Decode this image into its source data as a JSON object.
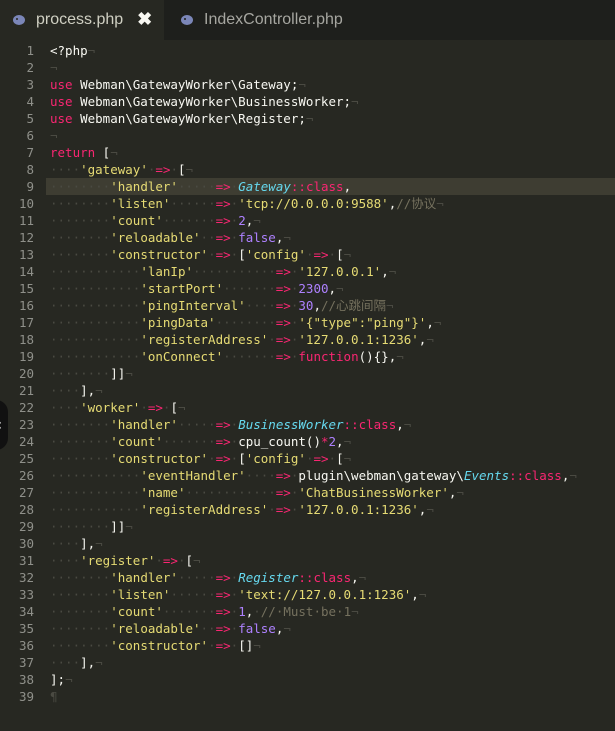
{
  "tabs": [
    {
      "label": "process.php",
      "active": true,
      "close_glyph": "✖",
      "icon": "php-elephant-icon"
    },
    {
      "label": "IndexController.php",
      "active": false,
      "icon": "php-elephant-icon"
    }
  ],
  "current_line": 9,
  "colors": {
    "background": "#272822",
    "keyword": "#f92672",
    "string": "#e6db74",
    "number": "#ae81ff",
    "class": "#66d9ef",
    "comment": "#75715e"
  },
  "lines": [
    [
      [
        "t",
        "<?php"
      ],
      [
        "w",
        "¬"
      ]
    ],
    [
      [
        "w",
        "¬"
      ]
    ],
    [
      [
        "kw",
        "use"
      ],
      [
        "t",
        " Webman\\GatewayWorker\\Gateway;"
      ],
      [
        "w",
        "¬"
      ]
    ],
    [
      [
        "kw",
        "use"
      ],
      [
        "t",
        " Webman\\GatewayWorker\\BusinessWorker;"
      ],
      [
        "w",
        "¬"
      ]
    ],
    [
      [
        "kw",
        "use"
      ],
      [
        "t",
        " Webman\\GatewayWorker\\Register;"
      ],
      [
        "w",
        "¬"
      ]
    ],
    [
      [
        "w",
        "¬"
      ]
    ],
    [
      [
        "kw",
        "return"
      ],
      [
        "t",
        " ["
      ],
      [
        "w",
        "¬"
      ]
    ],
    [
      [
        "w",
        "····"
      ],
      [
        "str",
        "'gateway'"
      ],
      [
        "w",
        "·"
      ],
      [
        "op",
        "=>"
      ],
      [
        "w",
        "·"
      ],
      [
        "t",
        "["
      ],
      [
        "w",
        "¬"
      ]
    ],
    [
      [
        "w",
        "········"
      ],
      [
        "str",
        "'handler'"
      ],
      [
        "w",
        "·····"
      ],
      [
        "op",
        "=>"
      ],
      [
        "w",
        "·"
      ],
      [
        "cls",
        "Gateway"
      ],
      [
        "op",
        "::"
      ],
      [
        "kw",
        "class"
      ],
      [
        "t",
        ","
      ]
    ],
    [
      [
        "w",
        "········"
      ],
      [
        "str",
        "'listen'"
      ],
      [
        "w",
        "······"
      ],
      [
        "op",
        "=>"
      ],
      [
        "w",
        "·"
      ],
      [
        "str",
        "'tcp://0.0.0.0:9588'"
      ],
      [
        "t",
        ","
      ],
      [
        "cm",
        "//协议"
      ],
      [
        "w",
        "¬"
      ]
    ],
    [
      [
        "w",
        "········"
      ],
      [
        "str",
        "'count'"
      ],
      [
        "w",
        "·······"
      ],
      [
        "op",
        "=>"
      ],
      [
        "w",
        "·"
      ],
      [
        "num",
        "2"
      ],
      [
        "t",
        ","
      ],
      [
        "w",
        "¬"
      ]
    ],
    [
      [
        "w",
        "········"
      ],
      [
        "str",
        "'reloadable'"
      ],
      [
        "w",
        "··"
      ],
      [
        "op",
        "=>"
      ],
      [
        "w",
        "·"
      ],
      [
        "num",
        "false"
      ],
      [
        "t",
        ","
      ],
      [
        "w",
        "¬"
      ]
    ],
    [
      [
        "w",
        "········"
      ],
      [
        "str",
        "'constructor'"
      ],
      [
        "w",
        "·"
      ],
      [
        "op",
        "=>"
      ],
      [
        "w",
        "·"
      ],
      [
        "t",
        "["
      ],
      [
        "str",
        "'config'"
      ],
      [
        "w",
        "·"
      ],
      [
        "op",
        "=>"
      ],
      [
        "w",
        "·"
      ],
      [
        "t",
        "["
      ],
      [
        "w",
        "¬"
      ]
    ],
    [
      [
        "w",
        "············"
      ],
      [
        "str",
        "'lanIp'"
      ],
      [
        "w",
        "···········"
      ],
      [
        "op",
        "=>"
      ],
      [
        "w",
        "·"
      ],
      [
        "str",
        "'127.0.0.1'"
      ],
      [
        "t",
        ","
      ],
      [
        "w",
        "¬"
      ]
    ],
    [
      [
        "w",
        "············"
      ],
      [
        "str",
        "'startPort'"
      ],
      [
        "w",
        "·······"
      ],
      [
        "op",
        "=>"
      ],
      [
        "w",
        "·"
      ],
      [
        "num",
        "2300"
      ],
      [
        "t",
        ","
      ],
      [
        "w",
        "¬"
      ]
    ],
    [
      [
        "w",
        "············"
      ],
      [
        "str",
        "'pingInterval'"
      ],
      [
        "w",
        "····"
      ],
      [
        "op",
        "=>"
      ],
      [
        "w",
        "·"
      ],
      [
        "num",
        "30"
      ],
      [
        "t",
        ","
      ],
      [
        "cm",
        "//心跳间隔"
      ],
      [
        "w",
        "¬"
      ]
    ],
    [
      [
        "w",
        "············"
      ],
      [
        "str",
        "'pingData'"
      ],
      [
        "w",
        "········"
      ],
      [
        "op",
        "=>"
      ],
      [
        "w",
        "·"
      ],
      [
        "str",
        "'{\"type\":\"ping\"}'"
      ],
      [
        "t",
        ","
      ],
      [
        "w",
        "¬"
      ]
    ],
    [
      [
        "w",
        "············"
      ],
      [
        "str",
        "'registerAddress'"
      ],
      [
        "w",
        "·"
      ],
      [
        "op",
        "=>"
      ],
      [
        "w",
        "·"
      ],
      [
        "str",
        "'127.0.0.1:1236'"
      ],
      [
        "t",
        ","
      ],
      [
        "w",
        "¬"
      ]
    ],
    [
      [
        "w",
        "············"
      ],
      [
        "str",
        "'onConnect'"
      ],
      [
        "w",
        "·······"
      ],
      [
        "op",
        "=>"
      ],
      [
        "w",
        "·"
      ],
      [
        "kw",
        "function"
      ],
      [
        "t",
        "(){},"
      ],
      [
        "w",
        "¬"
      ]
    ],
    [
      [
        "w",
        "········"
      ],
      [
        "t",
        "]]"
      ],
      [
        "w",
        "¬"
      ]
    ],
    [
      [
        "w",
        "····"
      ],
      [
        "t",
        "],"
      ],
      [
        "w",
        "¬"
      ]
    ],
    [
      [
        "w",
        "····"
      ],
      [
        "str",
        "'worker'"
      ],
      [
        "w",
        "·"
      ],
      [
        "op",
        "=>"
      ],
      [
        "w",
        "·"
      ],
      [
        "t",
        "["
      ],
      [
        "w",
        "¬"
      ]
    ],
    [
      [
        "w",
        "········"
      ],
      [
        "str",
        "'handler'"
      ],
      [
        "w",
        "·····"
      ],
      [
        "op",
        "=>"
      ],
      [
        "w",
        "·"
      ],
      [
        "cls",
        "BusinessWorker"
      ],
      [
        "op",
        "::"
      ],
      [
        "kw",
        "class"
      ],
      [
        "t",
        ","
      ],
      [
        "w",
        "¬"
      ]
    ],
    [
      [
        "w",
        "········"
      ],
      [
        "str",
        "'count'"
      ],
      [
        "w",
        "·······"
      ],
      [
        "op",
        "=>"
      ],
      [
        "w",
        "·"
      ],
      [
        "t",
        "cpu_count()"
      ],
      [
        "op",
        "*"
      ],
      [
        "num",
        "2"
      ],
      [
        "t",
        ","
      ],
      [
        "w",
        "¬"
      ]
    ],
    [
      [
        "w",
        "········"
      ],
      [
        "str",
        "'constructor'"
      ],
      [
        "w",
        "·"
      ],
      [
        "op",
        "=>"
      ],
      [
        "w",
        "·"
      ],
      [
        "t",
        "["
      ],
      [
        "str",
        "'config'"
      ],
      [
        "w",
        "·"
      ],
      [
        "op",
        "=>"
      ],
      [
        "w",
        "·"
      ],
      [
        "t",
        "["
      ],
      [
        "w",
        "¬"
      ]
    ],
    [
      [
        "w",
        "············"
      ],
      [
        "str",
        "'eventHandler'"
      ],
      [
        "w",
        "····"
      ],
      [
        "op",
        "=>"
      ],
      [
        "w",
        "·"
      ],
      [
        "t",
        "plugin\\webman\\gateway\\"
      ],
      [
        "cls",
        "Events"
      ],
      [
        "op",
        "::"
      ],
      [
        "kw",
        "class"
      ],
      [
        "t",
        ","
      ],
      [
        "w",
        "¬"
      ]
    ],
    [
      [
        "w",
        "············"
      ],
      [
        "str",
        "'name'"
      ],
      [
        "w",
        "············"
      ],
      [
        "op",
        "=>"
      ],
      [
        "w",
        "·"
      ],
      [
        "str",
        "'ChatBusinessWorker'"
      ],
      [
        "t",
        ","
      ],
      [
        "w",
        "¬"
      ]
    ],
    [
      [
        "w",
        "············"
      ],
      [
        "str",
        "'registerAddress'"
      ],
      [
        "w",
        "·"
      ],
      [
        "op",
        "=>"
      ],
      [
        "w",
        "·"
      ],
      [
        "str",
        "'127.0.0.1:1236'"
      ],
      [
        "t",
        ","
      ],
      [
        "w",
        "¬"
      ]
    ],
    [
      [
        "w",
        "········"
      ],
      [
        "t",
        "]]"
      ],
      [
        "w",
        "¬"
      ]
    ],
    [
      [
        "w",
        "····"
      ],
      [
        "t",
        "],"
      ],
      [
        "w",
        "¬"
      ]
    ],
    [
      [
        "w",
        "····"
      ],
      [
        "str",
        "'register'"
      ],
      [
        "w",
        "·"
      ],
      [
        "op",
        "=>"
      ],
      [
        "w",
        "·"
      ],
      [
        "t",
        "["
      ],
      [
        "w",
        "¬"
      ]
    ],
    [
      [
        "w",
        "········"
      ],
      [
        "str",
        "'handler'"
      ],
      [
        "w",
        "·····"
      ],
      [
        "op",
        "=>"
      ],
      [
        "w",
        "·"
      ],
      [
        "cls",
        "Register"
      ],
      [
        "op",
        "::"
      ],
      [
        "kw",
        "class"
      ],
      [
        "t",
        ","
      ],
      [
        "w",
        "¬"
      ]
    ],
    [
      [
        "w",
        "········"
      ],
      [
        "str",
        "'listen'"
      ],
      [
        "w",
        "······"
      ],
      [
        "op",
        "=>"
      ],
      [
        "w",
        "·"
      ],
      [
        "str",
        "'text://127.0.0.1:1236'"
      ],
      [
        "t",
        ","
      ],
      [
        "w",
        "¬"
      ]
    ],
    [
      [
        "w",
        "········"
      ],
      [
        "str",
        "'count'"
      ],
      [
        "w",
        "·······"
      ],
      [
        "op",
        "=>"
      ],
      [
        "w",
        "·"
      ],
      [
        "num",
        "1"
      ],
      [
        "t",
        ","
      ],
      [
        "w",
        "·"
      ],
      [
        "cm",
        "//·Must·be·1"
      ],
      [
        "w",
        "¬"
      ]
    ],
    [
      [
        "w",
        "········"
      ],
      [
        "str",
        "'reloadable'"
      ],
      [
        "w",
        "··"
      ],
      [
        "op",
        "=>"
      ],
      [
        "w",
        "·"
      ],
      [
        "num",
        "false"
      ],
      [
        "t",
        ","
      ],
      [
        "w",
        "¬"
      ]
    ],
    [
      [
        "w",
        "········"
      ],
      [
        "str",
        "'constructor'"
      ],
      [
        "w",
        "·"
      ],
      [
        "op",
        "=>"
      ],
      [
        "w",
        "·"
      ],
      [
        "t",
        "[]"
      ],
      [
        "w",
        "¬"
      ]
    ],
    [
      [
        "w",
        "····"
      ],
      [
        "t",
        "],"
      ],
      [
        "w",
        "¬"
      ]
    ],
    [
      [
        "t",
        "];"
      ],
      [
        "w",
        "¬"
      ]
    ],
    [
      [
        "w",
        "¶"
      ]
    ]
  ]
}
